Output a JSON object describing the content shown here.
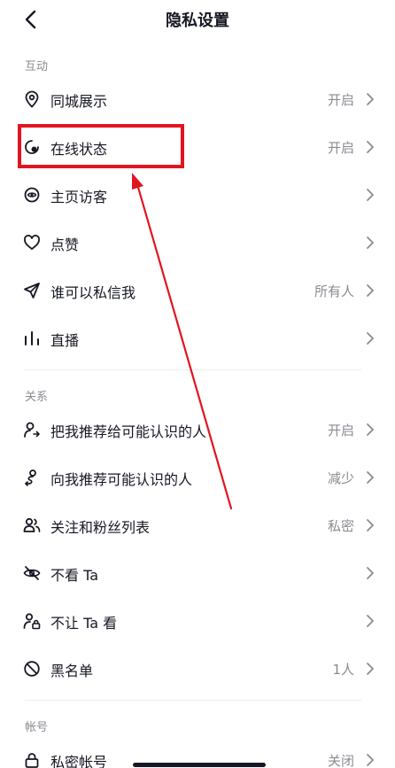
{
  "header": {
    "title": "隐私设置",
    "back_icon": "chevron-left-icon"
  },
  "sections": {
    "interaction": "互动",
    "relations": "关系",
    "account": "帐号"
  },
  "rows": {
    "same_city": {
      "label": "同城展示",
      "value": "开启",
      "icon": "location-pin-icon"
    },
    "online_status": {
      "label": "在线状态",
      "value": "开启",
      "icon": "online-status-icon"
    },
    "profile_visitors": {
      "label": "主页访客",
      "value": "",
      "icon": "eye-icon"
    },
    "likes": {
      "label": "点赞",
      "value": "",
      "icon": "heart-icon"
    },
    "who_can_message": {
      "label": "谁可以私信我",
      "value": "所有人",
      "icon": "send-icon"
    },
    "live": {
      "label": "直播",
      "value": "",
      "icon": "live-bars-icon"
    },
    "recommend_me": {
      "label": "把我推荐给可能认识的人",
      "value": "开启",
      "icon": "share-user-icon"
    },
    "recommend_to_me": {
      "label": "向我推荐可能认识的人",
      "value": "减少",
      "icon": "people-route-icon"
    },
    "follow_list": {
      "label": "关注和粉丝列表",
      "value": "私密",
      "icon": "two-users-icon"
    },
    "dont_see": {
      "label": "不看 Ta",
      "value": "",
      "icon": "eye-off-icon"
    },
    "dont_let_see": {
      "label": "不让 Ta 看",
      "value": "",
      "icon": "user-lock-icon"
    },
    "blacklist": {
      "label": "黑名单",
      "value": "1人",
      "icon": "block-icon"
    },
    "private_account": {
      "label": "私密帐号",
      "value": "关闭",
      "icon": "lock-icon"
    }
  },
  "annotation": {
    "color": "#e1151f"
  }
}
